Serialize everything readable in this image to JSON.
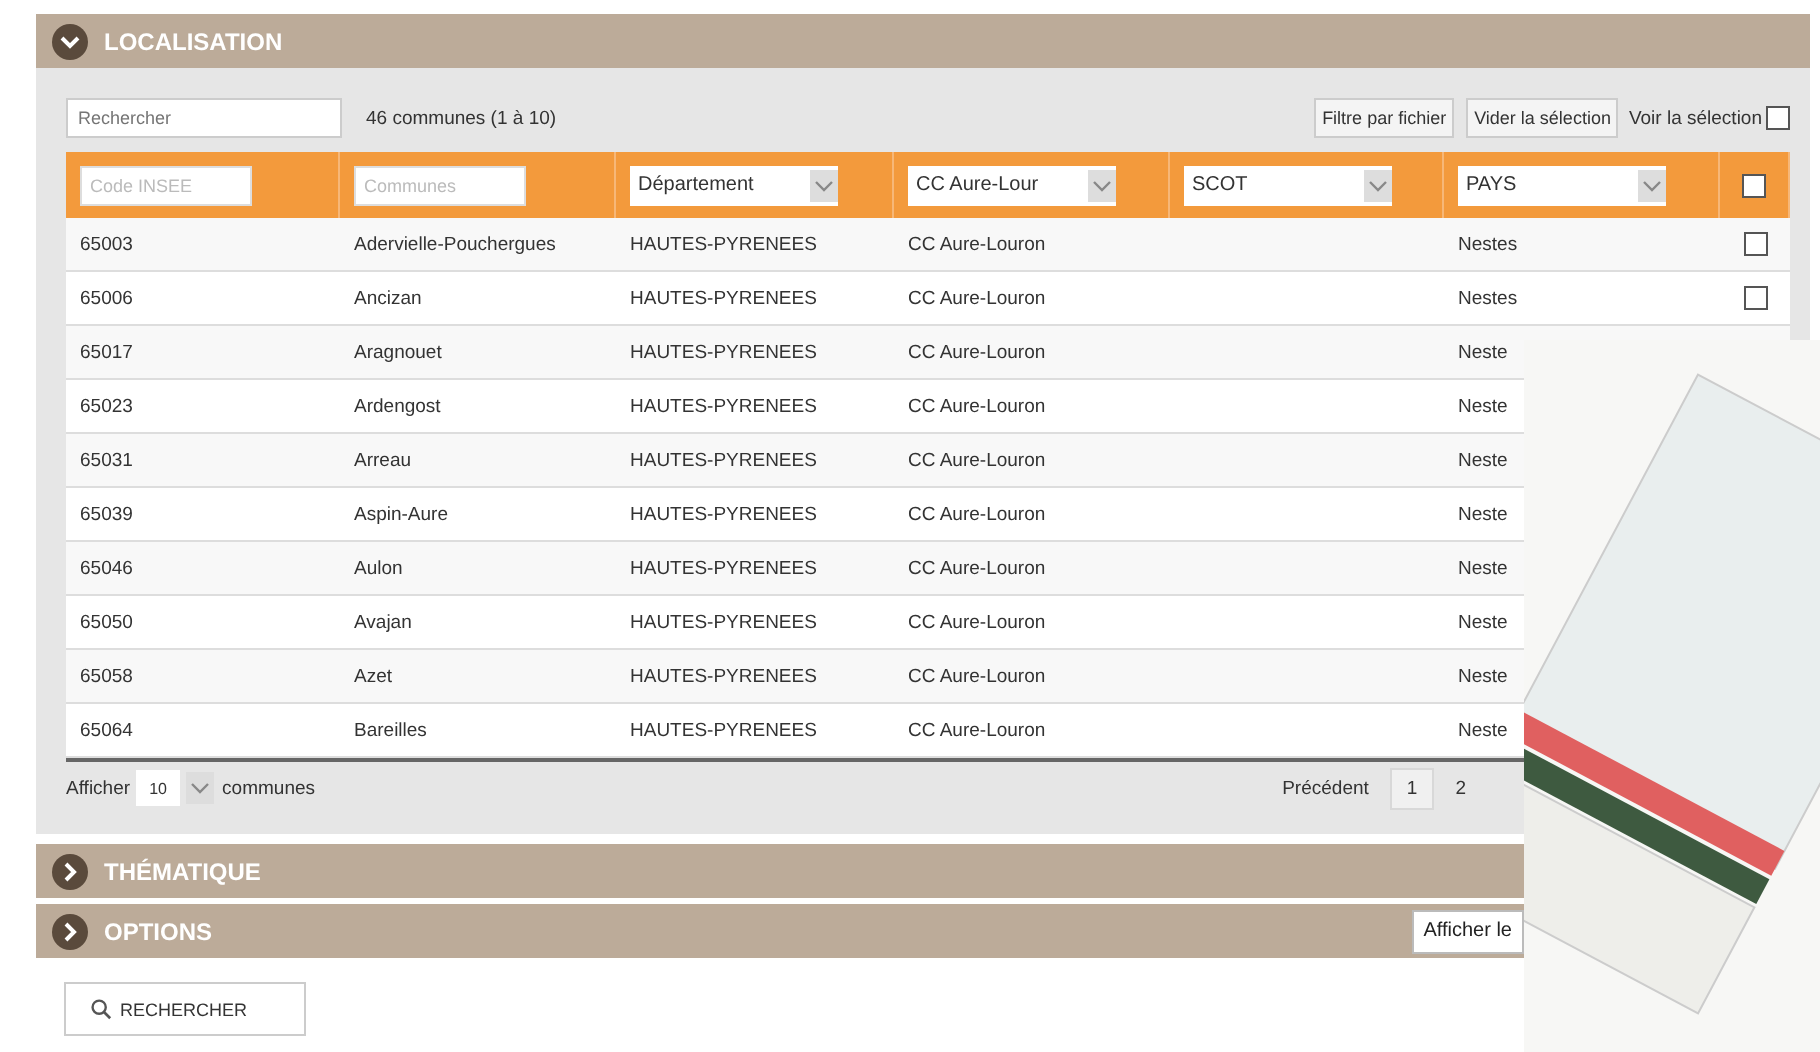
{
  "sections": [
    {
      "title": "LOCALISATION",
      "expanded": true
    },
    {
      "title": "THÉMATIQUE",
      "expanded": false
    },
    {
      "title": "OPTIONS",
      "expanded": false
    }
  ],
  "localisation": {
    "search": {
      "placeholder": "Rechercher"
    },
    "count": "46 communes (1 à 10)",
    "buttons": [
      "Filtre par fichier",
      "Vider la sélection"
    ],
    "show_selection": {
      "label": "Voir la sélection",
      "checked": false
    },
    "filters": [
      {
        "kind": "text",
        "placeholder": "Code INSEE"
      },
      {
        "kind": "text",
        "placeholder": "Communes"
      },
      {
        "kind": "select",
        "value": "Département"
      },
      {
        "kind": "select",
        "value": "CC Aure-Lour"
      },
      {
        "kind": "select",
        "value": "SCOT"
      },
      {
        "kind": "select",
        "value": "PAYS"
      },
      {
        "kind": "checkbox",
        "checked": false
      }
    ],
    "rows": [
      {
        "code": "65003",
        "commune": "Adervielle-Pouchergues",
        "departement": "HAUTES-PYRENEES",
        "cc": "CC Aure-Louron",
        "pays": "Nestes",
        "checked": false
      },
      {
        "code": "65006",
        "commune": "Ancizan",
        "departement": "HAUTES-PYRENEES",
        "cc": "CC Aure-Louron",
        "pays": "Nestes",
        "checked": false
      },
      {
        "code": "65017",
        "commune": "Aragnouet",
        "departement": "HAUTES-PYRENEES",
        "cc": "CC Aure-Louron",
        "pays": "Neste"
      },
      {
        "code": "65023",
        "commune": "Ardengost",
        "departement": "HAUTES-PYRENEES",
        "cc": "CC Aure-Louron",
        "pays": "Neste"
      },
      {
        "code": "65031",
        "commune": "Arreau",
        "departement": "HAUTES-PYRENEES",
        "cc": "CC Aure-Louron",
        "pays": "Neste"
      },
      {
        "code": "65039",
        "commune": "Aspin-Aure",
        "departement": "HAUTES-PYRENEES",
        "cc": "CC Aure-Louron",
        "pays": "Neste"
      },
      {
        "code": "65046",
        "commune": "Aulon",
        "departement": "HAUTES-PYRENEES",
        "cc": "CC Aure-Louron",
        "pays": "Neste"
      },
      {
        "code": "65050",
        "commune": "Avajan",
        "departement": "HAUTES-PYRENEES",
        "cc": "CC Aure-Louron",
        "pays": "Neste"
      },
      {
        "code": "65058",
        "commune": "Azet",
        "departement": "HAUTES-PYRENEES",
        "cc": "CC Aure-Louron",
        "pays": "Neste"
      },
      {
        "code": "65064",
        "commune": "Bareilles",
        "departement": "HAUTES-PYRENEES",
        "cc": "CC Aure-Louron",
        "pays": "Neste"
      }
    ],
    "page_size": {
      "label": "Afficher",
      "value": "10",
      "suffix": "communes"
    },
    "pagination": {
      "previous": "Précédent",
      "pages": [
        {
          "label": "1",
          "selected": true
        },
        {
          "label": "2",
          "selected": false
        }
      ]
    }
  },
  "options": {
    "button": "Afficher le"
  },
  "search_button": "RECHERCHER"
}
